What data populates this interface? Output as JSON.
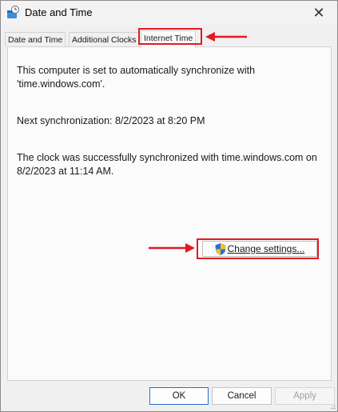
{
  "window": {
    "title": "Date and Time"
  },
  "tabs": [
    {
      "label": "Date and Time",
      "active": false
    },
    {
      "label": "Additional Clocks",
      "active": false
    },
    {
      "label": "Internet Time",
      "active": true
    }
  ],
  "content": {
    "line1": "This computer is set to automatically synchronize with 'time.windows.com'.",
    "next_sync": "Next synchronization: 8/2/2023 at 8:20 PM",
    "last_sync": "The clock was successfully synchronized with time.windows.com on 8/2/2023 at 11:14 AM."
  },
  "change_settings": {
    "label": "Change settings...",
    "icon": "uac-shield-icon"
  },
  "footer": {
    "ok": "OK",
    "cancel": "Cancel",
    "apply": "Apply",
    "apply_enabled": false
  },
  "annotations": {
    "highlight_color": "#e21b22"
  },
  "icons": {
    "close": "close-icon",
    "app": "clock-icon"
  }
}
